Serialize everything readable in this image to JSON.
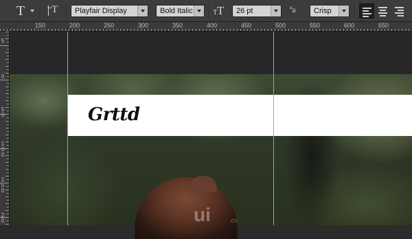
{
  "options_bar": {
    "tool_glyph": "T",
    "orient_glyph": "T",
    "font_family": "Playfair Display",
    "font_style": "Bold Italic",
    "size_glyph_large": "T",
    "size_glyph_small": "T",
    "font_size": "26 pt",
    "aa_glyph": "ªa",
    "anti_alias": "Crisp"
  },
  "ruler": {
    "labels": [
      "150",
      "200",
      "250",
      "300",
      "350",
      "400",
      "450",
      "500",
      "550",
      "600",
      "650"
    ],
    "v_labels": [
      "5",
      "0",
      "50",
      "100",
      "150",
      "20"
    ]
  },
  "canvas": {
    "headline": "Grttd",
    "guide_color": "#22d8e0"
  },
  "watermark": {
    "text": "ui",
    "suffix": ".cn"
  }
}
